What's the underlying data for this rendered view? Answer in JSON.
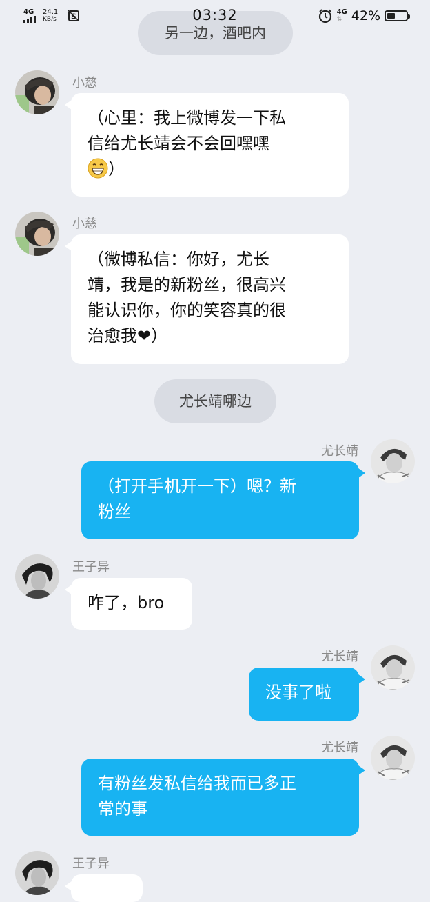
{
  "status_bar": {
    "network_left": "4G",
    "speed_value": "24.1",
    "speed_unit": "KB/s",
    "time": "03:32",
    "network_right": "4G",
    "battery": "42%",
    "battery_level": 0.42
  },
  "messages": [
    {
      "type": "system",
      "text": "另一边，酒吧内"
    },
    {
      "type": "left",
      "name": "小慈",
      "lines": [
        "（心里：我上微博发一下私",
        "信给尤长靖会不会回嘿嘿"
      ],
      "tail_emoji": "grinning-emoji",
      "tail_text": "）"
    },
    {
      "type": "left",
      "name": "小慈",
      "lines": [
        "（微博私信：你好，尤长",
        "靖，我是的新粉丝，很高兴",
        "能认识你，你的笑容真的很"
      ],
      "last_line": "治愈我",
      "heart": "❤",
      "tail_text": "）"
    },
    {
      "type": "system",
      "text": "尤长靖哪边"
    },
    {
      "type": "right",
      "name": "尤长靖",
      "lines": [
        "（打开手机开一下）嗯？新",
        "粉丝"
      ]
    },
    {
      "type": "left",
      "name": "王子异",
      "lines": [
        "咋了，bro"
      ]
    },
    {
      "type": "right",
      "name": "尤长靖",
      "lines": [
        "没事了啦"
      ]
    },
    {
      "type": "right",
      "name": "尤长靖",
      "lines": [
        "有粉丝发私信给我而已多正",
        "常的事"
      ]
    },
    {
      "type": "left",
      "name": "王子异",
      "lines": [
        ""
      ]
    }
  ],
  "colors": {
    "background": "#eceef3",
    "left_bubble": "#ffffff",
    "right_bubble": "#18b3f2",
    "system_pill": "#d9dce3"
  }
}
